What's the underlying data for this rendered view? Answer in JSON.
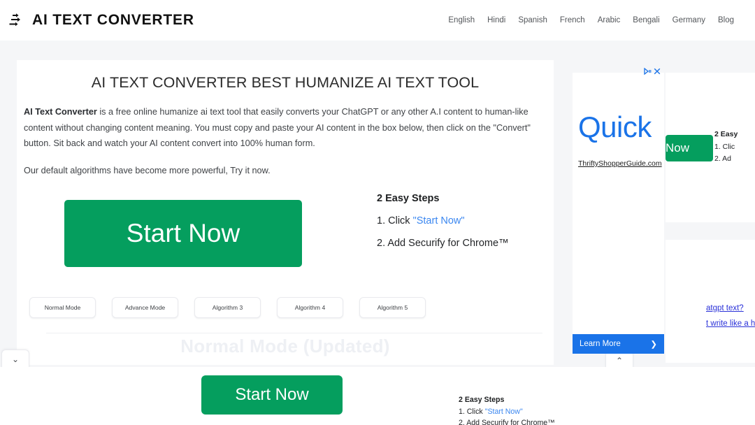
{
  "header": {
    "brand_text": "AI TEXT CONVERTER",
    "brand_icon": "converter-logo-icon",
    "nav": [
      {
        "label": "English"
      },
      {
        "label": "Hindi"
      },
      {
        "label": "Spanish"
      },
      {
        "label": "French"
      },
      {
        "label": "Arabic"
      },
      {
        "label": "Bengali"
      },
      {
        "label": "Germany"
      },
      {
        "label": "Blog"
      }
    ]
  },
  "main": {
    "title": "AI TEXT CONVERTER BEST HUMANIZE AI TEXT TOOL",
    "intro_strong": "AI Text Converter",
    "intro_rest": " is a free online humanize ai text tool that easily converts your ChatGPT or any other A.I content to human-like content without changing content meaning. You must copy and paste your AI content in the box below, then click on the \"Convert\" button. Sit back and watch your AI content convert into 100% human form.",
    "intro_2": "Our default algorithms have become more powerful, Try it now.",
    "cta_label": "Start Now",
    "steps": {
      "title": "2 Easy Steps",
      "step_1_prefix": "1. Click ",
      "step_1_link": "\"Start Now\"",
      "step_2": "2. Add Securify for Chrome™"
    },
    "modes": [
      {
        "label": "Normal Mode"
      },
      {
        "label": "Advance Mode"
      },
      {
        "label": "Algorithm 3"
      },
      {
        "label": "Algorithm 4"
      },
      {
        "label": "Algorithm 5"
      }
    ],
    "section_watermark": "Normal Mode (Updated)"
  },
  "chevrons": {
    "left_glyph": "⌄",
    "mid_glyph": "⌃",
    "left_name": "scroll-down-chevron",
    "mid_name": "scroll-up-chevron"
  },
  "rail": {
    "green_btn_label": "Now",
    "steps": {
      "title": "2 Easy",
      "step_1": "1. Clic",
      "step_2": "2. Ad"
    },
    "links": [
      {
        "label": "atgpt text?"
      },
      {
        "label": "t write like a human in"
      }
    ]
  },
  "ad": {
    "watermark_text": "ThriftyShopperGuide",
    "headline": "Quick",
    "domain": "ThriftyShopperGuide.com",
    "learn_more_label": "Learn More",
    "learn_more_arrow": "❯",
    "adchoices_icon": "adchoices-triangle-icon",
    "close_icon": "close-icon"
  },
  "sticky": {
    "cta_label": "Start Now",
    "steps_title": "2 Easy Steps",
    "step_1_prefix": "1. Click ",
    "step_1_link": "\"Start Now\"",
    "step_2": "2. Add Securify for Chrome™"
  },
  "colors": {
    "green": "#059e5e",
    "blue_link": "#3b87f0",
    "ad_blue": "#1a73e8",
    "page_bg": "#f5f6f8",
    "rail_link_blue": "#2a31d8"
  }
}
